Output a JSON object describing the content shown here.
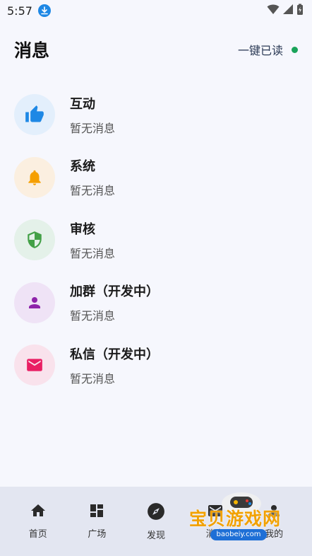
{
  "status_bar": {
    "time": "5:57"
  },
  "header": {
    "title": "消息",
    "mark_all_read": "一键已读"
  },
  "messages": [
    {
      "title": "互动",
      "subtitle": "暂无消息",
      "icon": "thumbs-up-icon",
      "bg": "#e3effc",
      "color": "#1e88e5"
    },
    {
      "title": "系统",
      "subtitle": "暂无消息",
      "icon": "bell-icon",
      "bg": "#fbefe0",
      "color": "#f59f00"
    },
    {
      "title": "审核",
      "subtitle": "暂无消息",
      "icon": "shield-icon",
      "bg": "#e4f1e9",
      "color": "#43a047"
    },
    {
      "title": "加群（开发中）",
      "subtitle": "暂无消息",
      "icon": "person-icon",
      "bg": "#efe3f6",
      "color": "#8e24aa"
    },
    {
      "title": "私信（开发中）",
      "subtitle": "暂无消息",
      "icon": "mail-icon",
      "bg": "#f9e2ec",
      "color": "#e91e63"
    }
  ],
  "bottom_nav": [
    {
      "label": "首页",
      "icon": "home-icon"
    },
    {
      "label": "广场",
      "icon": "dashboard-icon"
    },
    {
      "label": "发现",
      "icon": "compass-icon"
    },
    {
      "label": "消息",
      "icon": "mail-icon"
    },
    {
      "label": "我的",
      "icon": "person-icon"
    }
  ],
  "watermark": {
    "text": "宝贝游戏网",
    "url": "baobeiy.com"
  }
}
